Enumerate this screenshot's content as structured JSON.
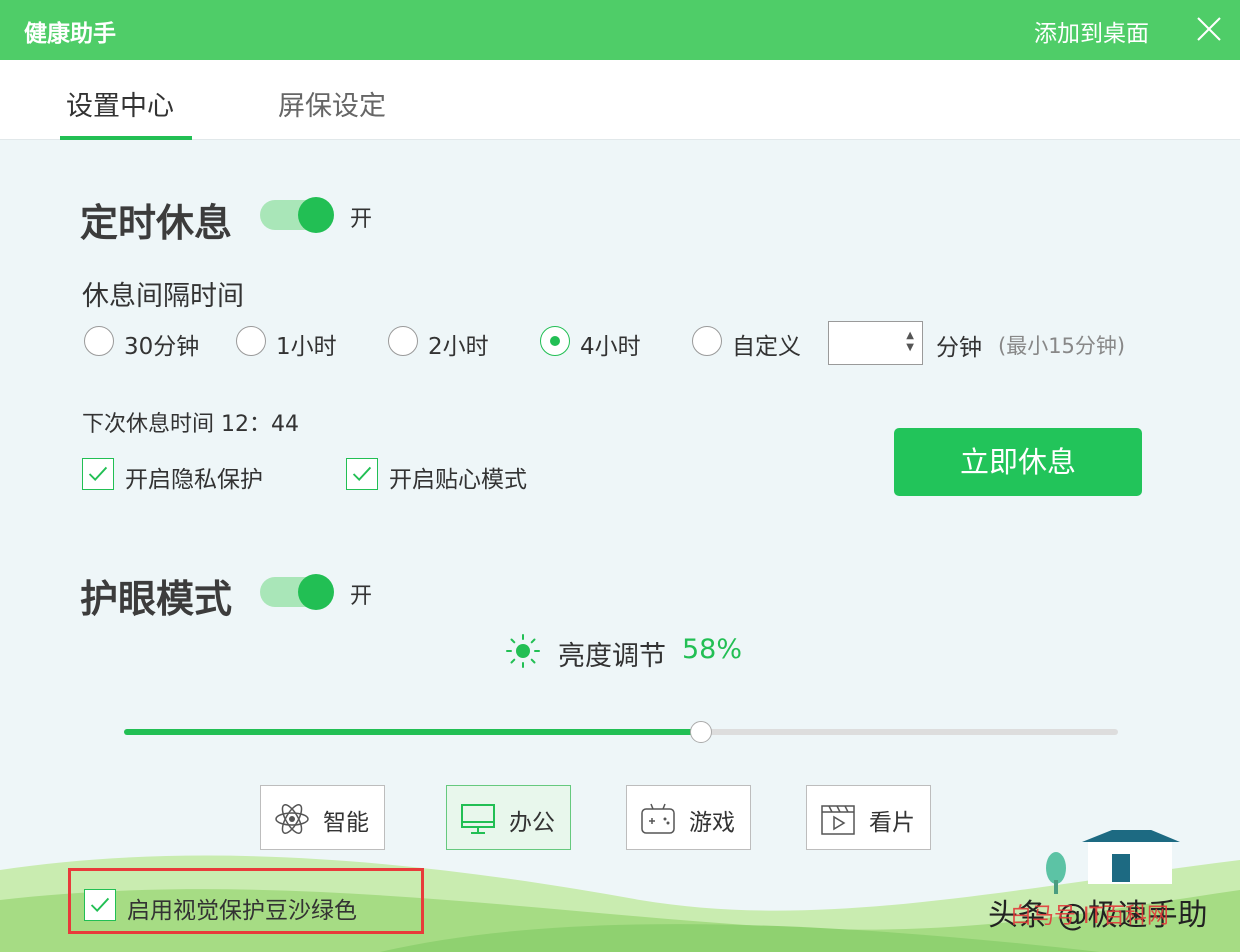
{
  "window": {
    "title": "健康助手",
    "add_to_desktop": "添加到桌面"
  },
  "tabs": [
    {
      "label": "设置中心",
      "active": true
    },
    {
      "label": "屏保设定",
      "active": false
    }
  ],
  "timed_rest": {
    "title": "定时休息",
    "toggle_text": "开",
    "enabled": true,
    "interval_label": "休息间隔时间",
    "options": [
      {
        "label": "30分钟",
        "checked": false
      },
      {
        "label": "1小时",
        "checked": false
      },
      {
        "label": "2小时",
        "checked": false
      },
      {
        "label": "4小时",
        "checked": true
      },
      {
        "label": "自定义",
        "checked": false
      }
    ],
    "custom_value": "",
    "unit": "分钟",
    "hint": "(最小15分钟)",
    "next_rest": "下次休息时间 12：44",
    "privacy": {
      "label": "开启隐私保护",
      "checked": true
    },
    "caring": {
      "label": "开启贴心模式",
      "checked": true
    },
    "rest_now": "立即休息"
  },
  "eye_care": {
    "title": "护眼模式",
    "toggle_text": "开",
    "enabled": true,
    "brightness_label": "亮度调节",
    "brightness_value": "58%",
    "brightness_level": 0.58,
    "modes": [
      {
        "label": "智能",
        "icon": "atom-icon",
        "active": false
      },
      {
        "label": "办公",
        "icon": "monitor-icon",
        "active": true
      },
      {
        "label": "游戏",
        "icon": "gamepad-icon",
        "active": false
      },
      {
        "label": "看片",
        "icon": "film-icon",
        "active": false
      }
    ],
    "bean_green": {
      "label": "启用视觉保护豆沙绿色",
      "checked": true
    }
  },
  "watermark": {
    "text": "头条 @极速手助",
    "overlay": "白马号 IT百科网"
  },
  "colors": {
    "brand_green": "#4fcd68",
    "accent_green": "#22bf54",
    "highlight_red": "#e83a3a"
  }
}
